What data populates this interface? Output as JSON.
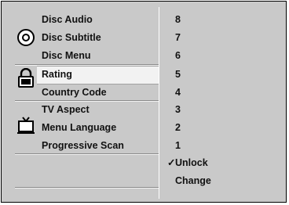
{
  "menu": {
    "groups": [
      {
        "icon": "disc-icon",
        "items": [
          "Disc Audio",
          "Disc Subtitle",
          "Disc Menu"
        ]
      },
      {
        "icon": "padlock-icon",
        "items": [
          "Rating",
          "Country Code"
        ]
      },
      {
        "icon": "tv-icon",
        "items": [
          "TV Aspect",
          "Menu Language",
          "Progressive Scan"
        ]
      }
    ],
    "selected": "Rating"
  },
  "submenu": {
    "options": [
      "8",
      "7",
      "6",
      "5",
      "4",
      "3",
      "2",
      "1",
      "Unlock",
      "Change"
    ],
    "checked": "Unlock",
    "check_mark": "✓"
  }
}
